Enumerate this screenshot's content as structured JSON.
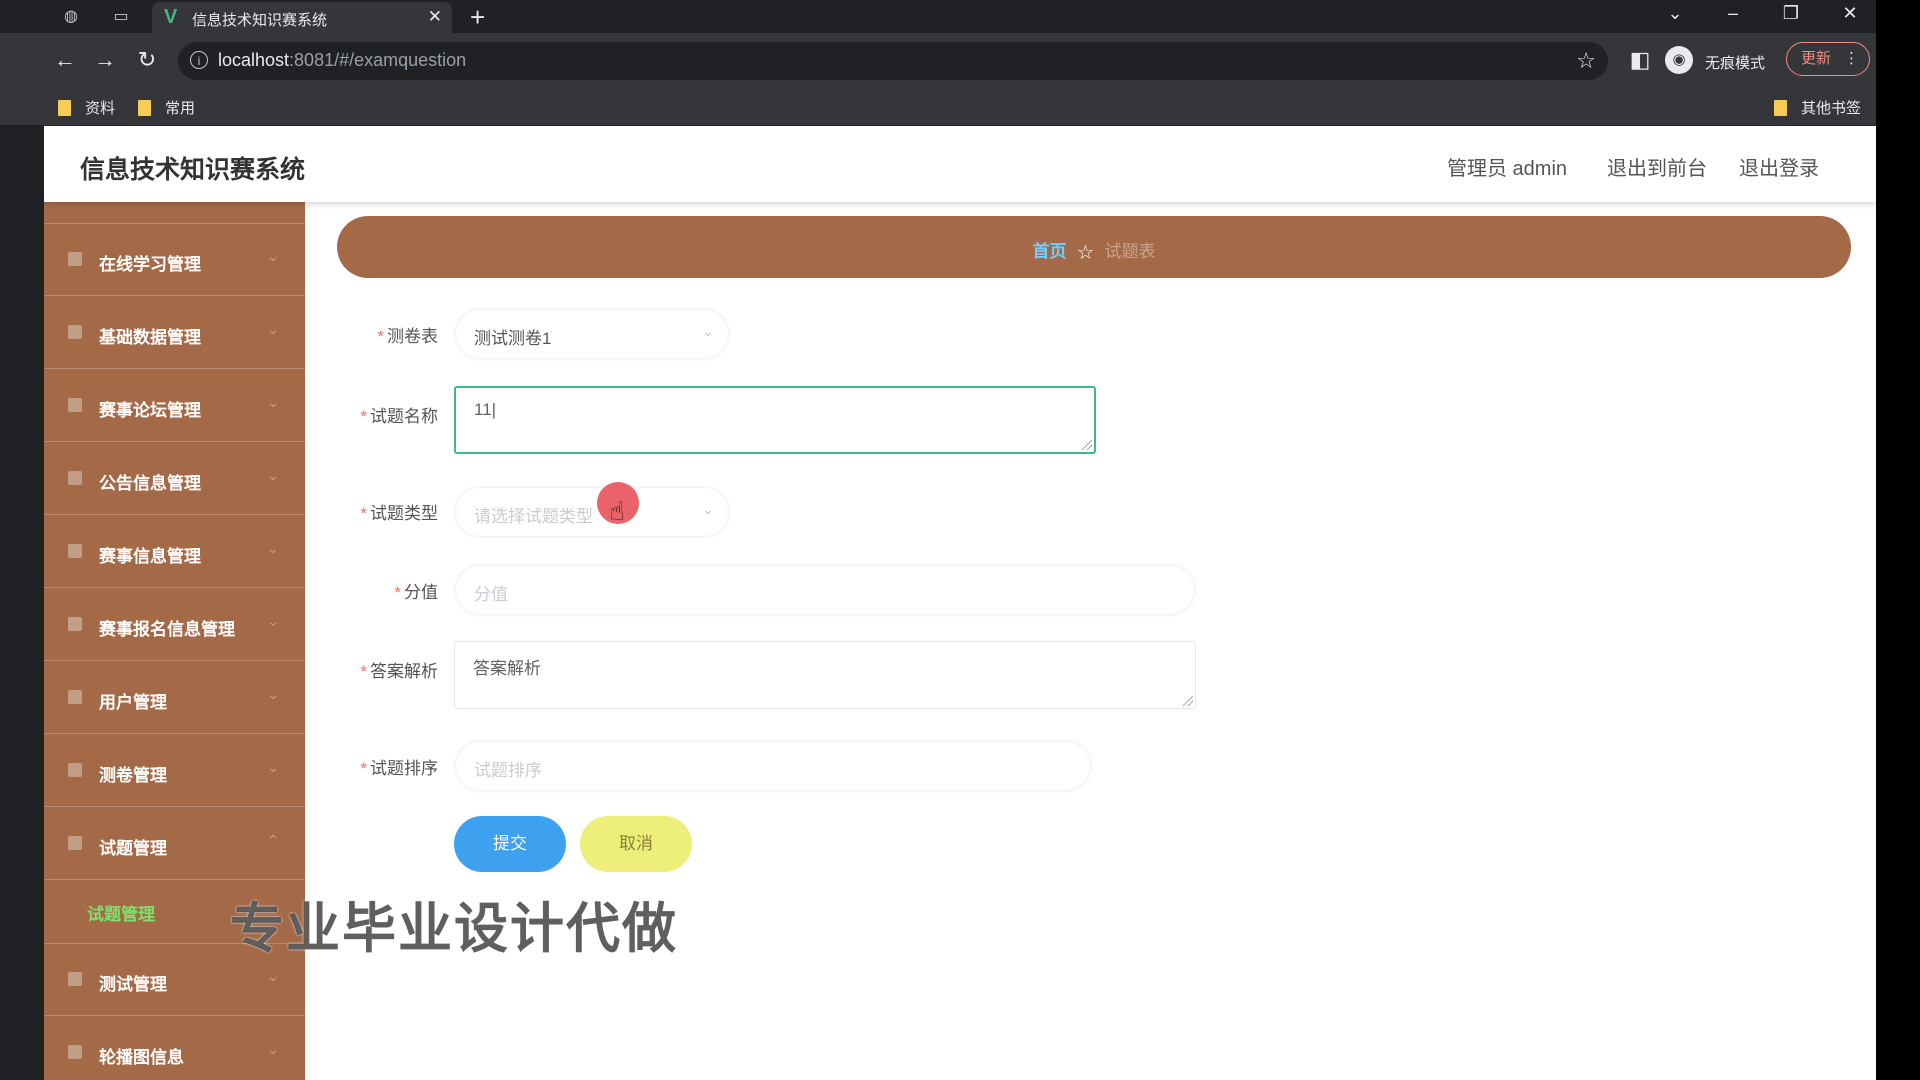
{
  "browser": {
    "tab_title": "信息技术知识赛系统",
    "url_host": "localhost",
    "url_path": ":8081/#/examquestion",
    "incognito_label": "无痕模式",
    "update_label": "更新",
    "bookmarks": [
      "资料",
      "常用"
    ],
    "other_bookmarks": "其他书签"
  },
  "header": {
    "title": "信息技术知识赛系统",
    "admin_label": "管理员 admin",
    "front_link": "退出到前台",
    "logout_link": "退出登录"
  },
  "sidebar": {
    "items": [
      {
        "label": "在线学习管理"
      },
      {
        "label": "基础数据管理"
      },
      {
        "label": "赛事论坛管理"
      },
      {
        "label": "公告信息管理"
      },
      {
        "label": "赛事信息管理"
      },
      {
        "label": "赛事报名信息管理"
      },
      {
        "label": "用户管理"
      },
      {
        "label": "测卷管理"
      },
      {
        "label": "试题管理"
      },
      {
        "label": "测试管理"
      },
      {
        "label": "轮播图信息"
      }
    ],
    "active_sub": "试题管理"
  },
  "breadcrumb": {
    "home": "首页",
    "current": "试题表"
  },
  "form": {
    "paper_label": "测卷表",
    "paper_value": "测试测卷1",
    "name_label": "试题名称",
    "name_value": "11|",
    "type_label": "试题类型",
    "type_placeholder": "请选择试题类型",
    "score_label": "分值",
    "score_placeholder": "分值",
    "analysis_label": "答案解析",
    "analysis_placeholder": "答案解析",
    "order_label": "试题排序",
    "order_placeholder": "试题排序",
    "submit_label": "提交",
    "cancel_label": "取消"
  },
  "watermark": "专业毕业设计代做",
  "colors": {
    "sidebar": "#a46a48",
    "active_sub": "#7ee06a",
    "submit": "#3ea1f0",
    "cancel": "#eeef7a",
    "focus_border": "#41b883"
  }
}
